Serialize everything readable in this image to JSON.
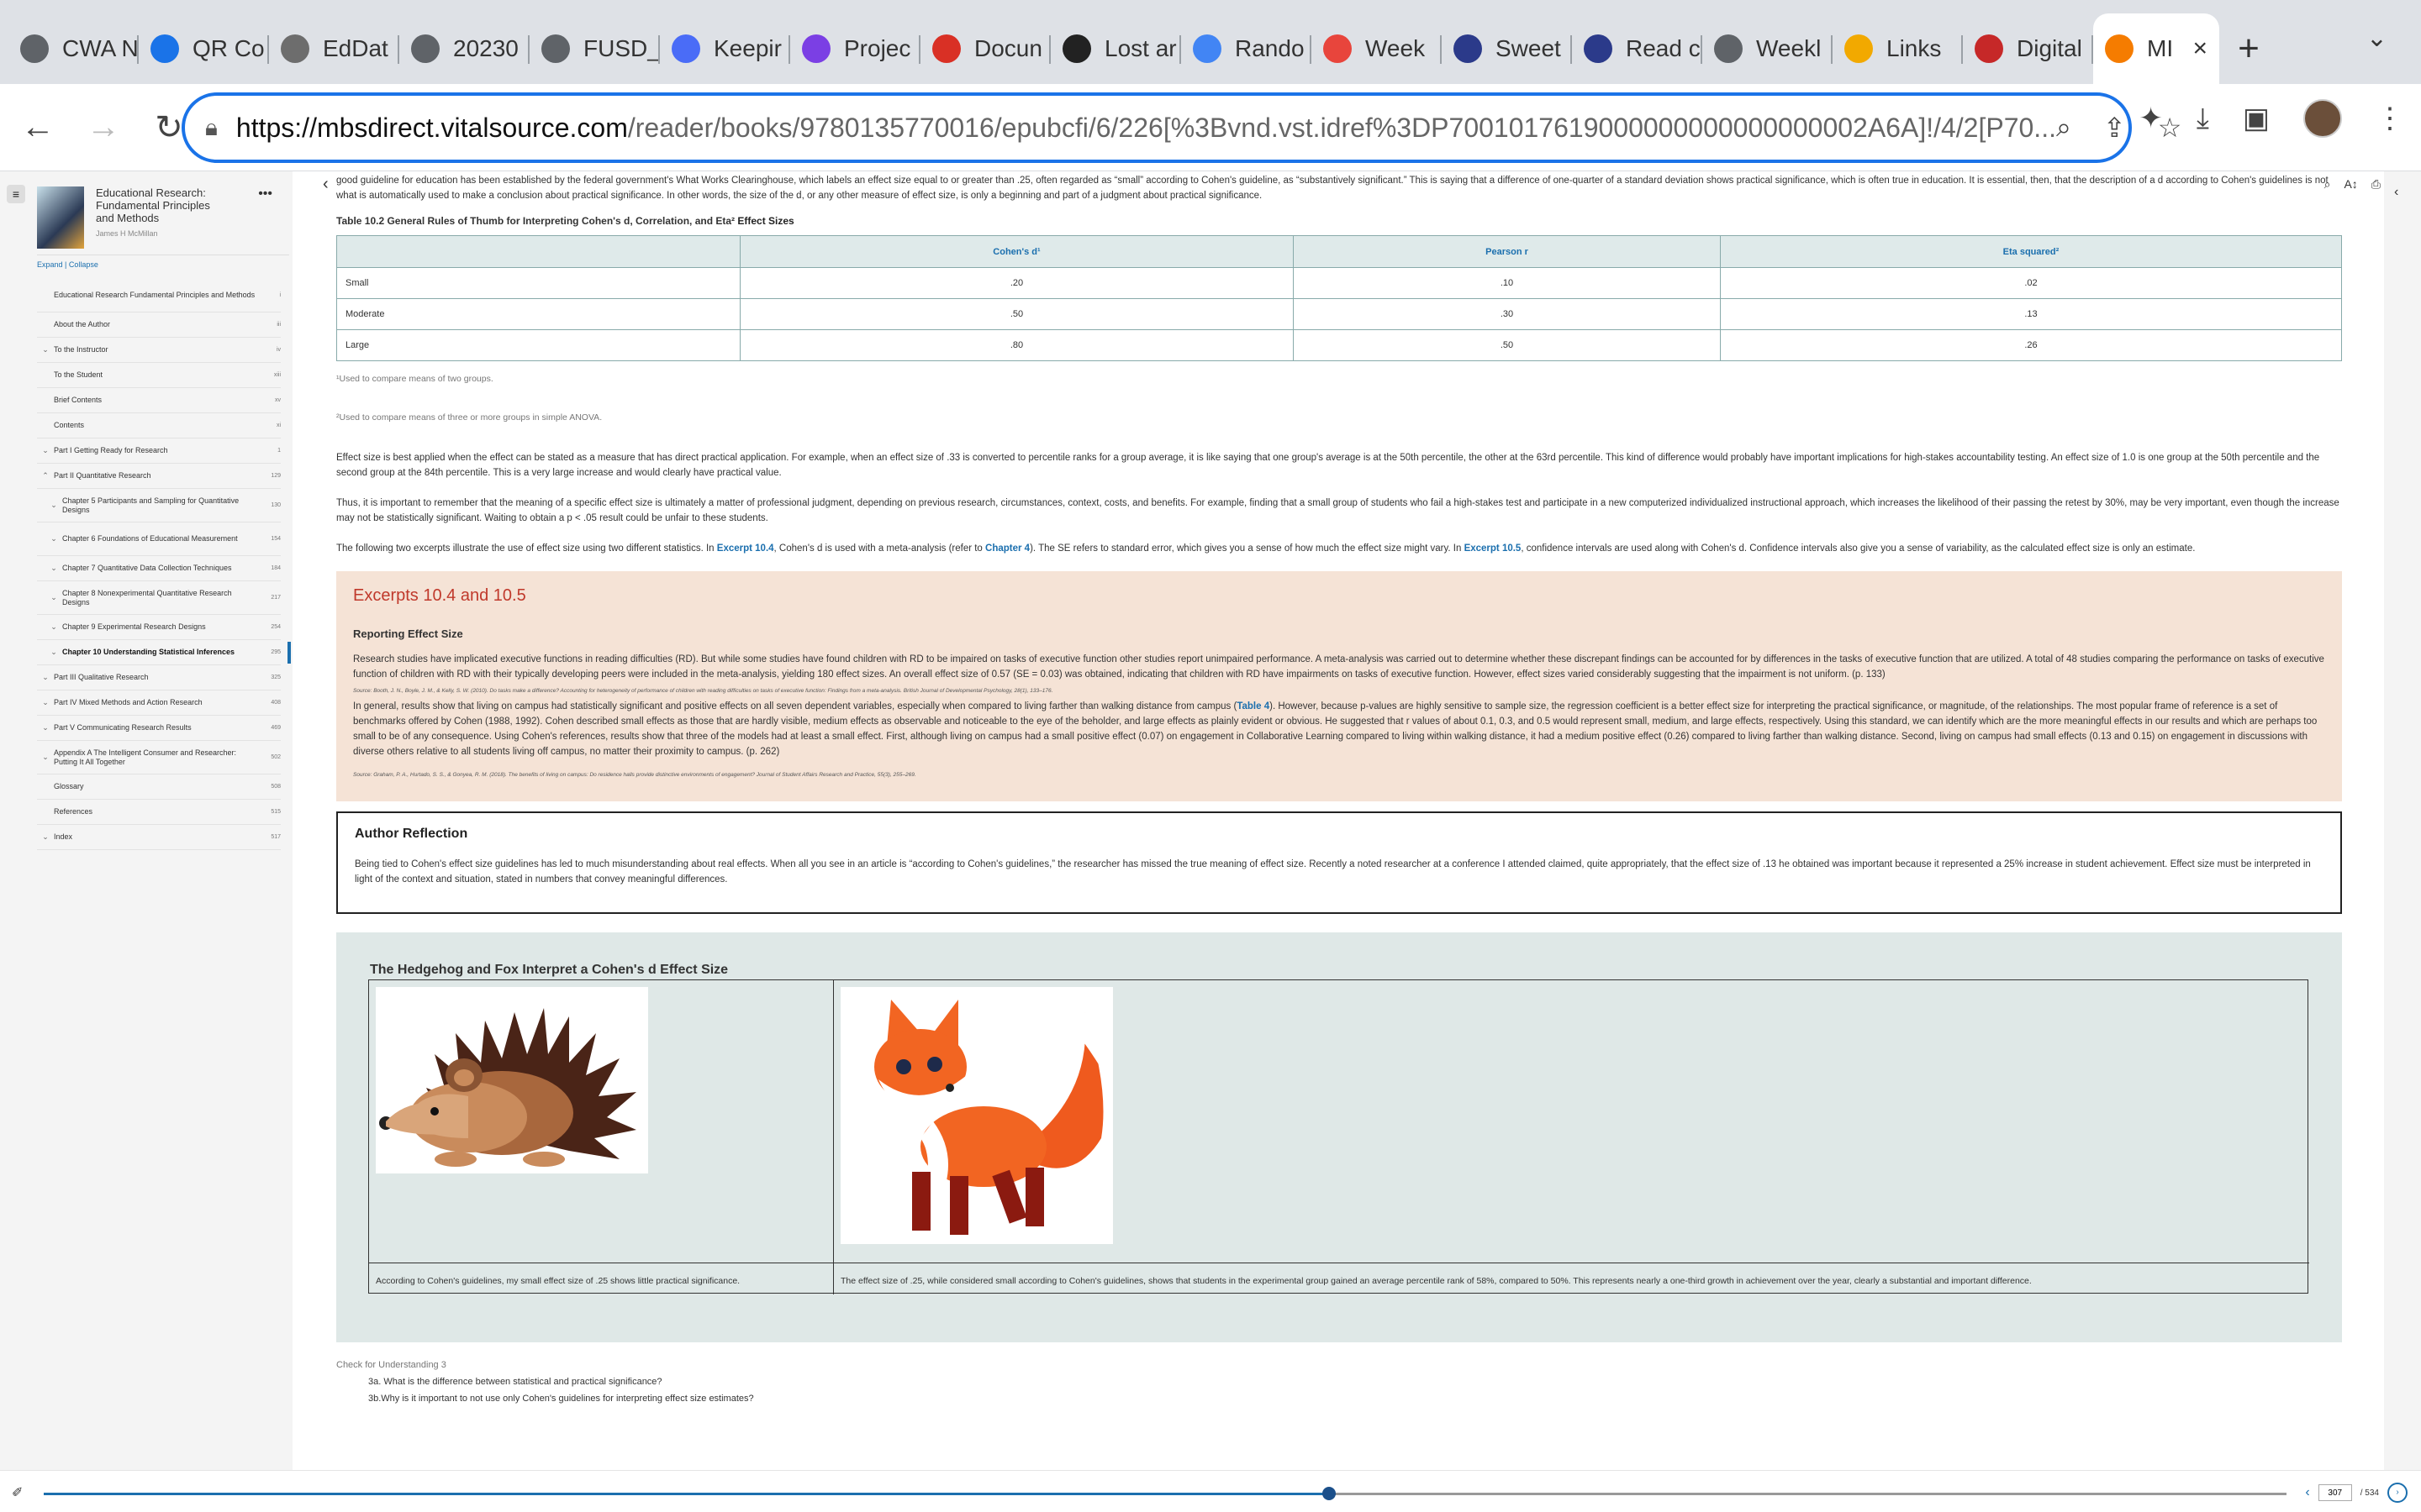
{
  "tabs": [
    {
      "label": "CWA N",
      "icon": "globe-icon",
      "color": "#5f6368"
    },
    {
      "label": "QR Co",
      "icon": "qr-icon",
      "color": "#1a73e8"
    },
    {
      "label": "EdDat",
      "icon": "doc-icon",
      "color": "#6d6d6d"
    },
    {
      "label": "20230",
      "icon": "globe-icon",
      "color": "#5f6368"
    },
    {
      "label": "FUSD_",
      "icon": "globe-icon",
      "color": "#5f6368"
    },
    {
      "label": "Keepir",
      "icon": "feather-icon",
      "color": "#4a6cf7"
    },
    {
      "label": "Projec",
      "icon": "c-icon",
      "color": "#7b3fe4"
    },
    {
      "label": "Docun",
      "icon": "docusign-icon",
      "color": "#d93025"
    },
    {
      "label": "Lost ar",
      "icon": "museum-icon",
      "color": "#222222"
    },
    {
      "label": "Rando",
      "icon": "google-icon",
      "color": "#4285f4"
    },
    {
      "label": "Week",
      "icon": "wheel-icon",
      "color": "#e8453c"
    },
    {
      "label": "Sweet",
      "icon": "gear-icon",
      "color": "#2b3a8a"
    },
    {
      "label": "Read c",
      "icon": "gear-icon",
      "color": "#2b3a8a"
    },
    {
      "label": "Weekl",
      "icon": "globe-icon",
      "color": "#5f6368"
    },
    {
      "label": "Links",
      "icon": "chart-icon",
      "color": "#f2a900"
    },
    {
      "label": "Digital",
      "icon": "book-icon",
      "color": "#c62828"
    },
    {
      "label": "MI",
      "icon": "vitalsource-icon",
      "color": "#f57c00",
      "active": true
    }
  ],
  "browser": {
    "url_host": "https://mbsdirect.vitalsource.com",
    "url_path": "/reader/books/9780135770016/epubcfi/6/226[%3Bvnd.vst.idref%3DP7001017619000000000000000002A6A]!/4/2[P70...",
    "new_tab_label": "+"
  },
  "book": {
    "title": "Educational Research: Fundamental Principles and Methods",
    "author": "James H McMillan",
    "more": "•••",
    "expand": "Expand",
    "sep": "|",
    "collapse": "Collapse"
  },
  "toc": [
    {
      "label": "Educational Research Fundamental Principles and Methods",
      "page": "i",
      "lvl": 0,
      "two": true,
      "chev": ""
    },
    {
      "label": "About the Author",
      "page": "iii",
      "lvl": 0,
      "chev": ""
    },
    {
      "label": "To the Instructor",
      "page": "iv",
      "lvl": 1,
      "chev": "⌄"
    },
    {
      "label": "To the Student",
      "page": "xiii",
      "lvl": 0,
      "chev": ""
    },
    {
      "label": "Brief Contents",
      "page": "xv",
      "lvl": 0,
      "chev": ""
    },
    {
      "label": "Contents",
      "page": "xi",
      "lvl": 0,
      "chev": ""
    },
    {
      "label": "Part I Getting Ready for Research",
      "page": "1",
      "lvl": 1,
      "chev": "⌄"
    },
    {
      "label": "Part II Quantitative Research",
      "page": "129",
      "lvl": 1,
      "chev": "⌃"
    },
    {
      "label": "Chapter 5 Participants and Sampling for Quantitative Designs",
      "page": "130",
      "lvl": 2,
      "two": true,
      "chev": "⌄"
    },
    {
      "label": "Chapter 6 Foundations of Educational Measurement",
      "page": "154",
      "lvl": 2,
      "two": true,
      "chev": "⌄"
    },
    {
      "label": "Chapter 7 Quantitative Data Collection Techniques",
      "page": "184",
      "lvl": 2,
      "chev": "⌄"
    },
    {
      "label": "Chapter 8 Nonexperimental Quantitative Research Designs",
      "page": "217",
      "lvl": 2,
      "two": true,
      "chev": "⌄"
    },
    {
      "label": "Chapter 9 Experimental Research Designs",
      "page": "254",
      "lvl": 2,
      "chev": "⌄"
    },
    {
      "label": "Chapter 10 Understanding Statistical Inferences",
      "page": "295",
      "lvl": 2,
      "chev": "⌄",
      "current": true
    },
    {
      "label": "Part III Qualitative Research",
      "page": "325",
      "lvl": 1,
      "chev": "⌄"
    },
    {
      "label": "Part IV Mixed Methods and Action Research",
      "page": "408",
      "lvl": 1,
      "chev": "⌄"
    },
    {
      "label": "Part V Communicating Research Results",
      "page": "469",
      "lvl": 1,
      "chev": "⌄"
    },
    {
      "label": "Appendix A The Intelligent Consumer and Researcher: Putting It All Together",
      "page": "502",
      "lvl": 1,
      "two": true,
      "chev": "⌄"
    },
    {
      "label": "Glossary",
      "page": "508",
      "lvl": 0,
      "chev": ""
    },
    {
      "label": "References",
      "page": "515",
      "lvl": 0,
      "chev": ""
    },
    {
      "label": "Index",
      "page": "517",
      "lvl": 1,
      "chev": "⌄"
    }
  ],
  "content": {
    "intro": "good guideline for education has been established by the federal government's What Works Clearinghouse, which labels an effect size equal to or greater than .25, often regarded as “small” according to Cohen's guideline, as “substantively significant.” This is saying that a difference of one-quarter of a standard deviation shows practical significance, which is often true in education. It is essential, then, that the description of a d according to Cohen's guidelines is not what is automatically used to make a conclusion about practical significance. In other words, the size of the d, or any other measure of effect size, is only a beginning and part of a judgment about practical significance.",
    "table_caption": "Table 10.2 General Rules of Thumb for Interpreting Cohen's d, Correlation, and Eta²",
    "table_caption_link": "Effect Sizes",
    "table_headers": [
      "",
      "Cohen's d¹",
      "Pearson r",
      "Eta squared²"
    ],
    "table_rows": [
      [
        "Small",
        ".20",
        ".10",
        ".02"
      ],
      [
        "Moderate",
        ".50",
        ".30",
        ".13"
      ],
      [
        "Large",
        ".80",
        ".50",
        ".26"
      ]
    ],
    "foot1": "¹Used to compare means of two groups.",
    "foot2": "²Used to compare means of three or more groups in simple ANOVA.",
    "p1": "Effect size is best applied when the effect can be stated as a measure that has direct practical application. For example, when an effect size of .33 is converted to percentile ranks for a group average, it is like saying that one group's average is at the 50th percentile, the other at the 63rd percentile. This kind of difference would probably have important implications for high-stakes accountability testing. An effect size of 1.0 is one group at the 50th percentile and the second group at the 84th percentile. This is a very large increase and would clearly have practical value.",
    "p2": "Thus, it is important to remember that the meaning of a specific effect size is ultimately a matter of professional judgment, depending on previous research, circumstances, context, costs, and benefits. For example, finding that a small group of students who fail a high-stakes test and participate in a new computerized individualized instructional approach, which increases the likelihood of their passing the retest by 30%, may be very important, even though the increase may not be statistically significant. Waiting to obtain a p < .05 result could be unfair to these students.",
    "p3_a": "The following two excerpts illustrate the use of effect size using two different statistics. In",
    "p3_link1": "Excerpt 10.4",
    "p3_b": ", Cohen's d is used with a meta-analysis (refer to",
    "p3_link2": "Chapter 4",
    "p3_c": "). The SE refers to standard error, which gives you a sense of how much the effect size might vary. In",
    "p3_link3": "Excerpt 10.5",
    "p3_d": ", confidence intervals are used along with Cohen's d. Confidence intervals also give you a sense of variability, as the calculated effect size is only an estimate.",
    "excerpt_title": "Excerpts 10.4 and 10.5",
    "excerpt_sub": "Reporting Effect Size",
    "excerpt_p1": "Research studies have implicated executive functions in reading difficulties (RD). But while some studies have found children with RD to be impaired on tasks of executive function other studies report unimpaired performance. A meta-analysis was carried out to determine whether these discrepant findings can be accounted for by differences in the tasks of executive function that are utilized. A total of 48 studies comparing the performance on tasks of executive function of children with RD with their typically developing peers were included in the meta-analysis, yielding 180 effect sizes. An overall effect size of 0.57 (SE = 0.03) was obtained, indicating that children with RD have impairments on tasks of executive function. However, effect sizes varied considerably suggesting that the impairment is not uniform. (p. 133)",
    "excerpt_src1": "Source: Booth, J. N., Boyle, J. M., & Kelly, S. W. (2010). Do tasks make a difference? Accounting for heterogeneity of performance of children with reading difficulties on tasks of executive function: Findings from a meta-analysis. British Journal of Developmental Psychology, 28(1), 133–176.",
    "excerpt_p2_a": "In general, results show that living on campus had statistically significant and positive effects on all seven dependent variables, especially when compared to living farther than walking distance from campus (",
    "excerpt_p2_link": "Table 4",
    "excerpt_p2_b": "). However, because p-values are highly sensitive to sample size, the regression coefficient is a better effect size for interpreting the practical significance, or magnitude, of the relationships. The most popular frame of reference is a set of benchmarks offered by Cohen (1988, 1992). Cohen described small effects as those that are hardly visible, medium effects as observable and noticeable to the eye of the beholder, and large effects as plainly evident or obvious. He suggested that r values of about 0.1, 0.3, and 0.5 would represent small, medium, and large effects, respectively. Using this standard, we can identify which are the more meaningful effects in our results and which are perhaps too small to be of any consequence. Using Cohen's references, results show that three of the models had at least a small effect. First, although living on campus had a small positive effect (0.07) on engagement in Collaborative Learning compared to living within walking distance, it had a medium positive effect (0.26) compared to living farther than walking distance. Second, living on campus had small effects (0.13 and 0.15) on engagement in discussions with diverse others relative to all students living off campus, no matter their proximity to campus. (p. 262)",
    "excerpt_src2": "Source: Graham, P. A., Hurtado, S. S., & Gonyea, R. M. (2018). The benefits of living on campus: Do residence halls provide distinctive environments of engagement? Journal of Student Affairs Research and Practice, 55(3), 255–269.",
    "reflect_title": "Author Reflection",
    "reflect_text": "Being tied to Cohen's effect size guidelines has led to much misunderstanding about real effects. When all you see in an article is “according to Cohen's guidelines,” the researcher has missed the true meaning of effect size. Recently a noted researcher at a conference I attended claimed, quite appropriately, that the effect size of .13 he obtained was important because it represented a 25% increase in student achievement. Effect size must be interpreted in light of the context and situation, stated in numbers that convey meaningful differences.",
    "hf_title": "The Hedgehog and Fox Interpret a Cohen's d Effect Size",
    "hf_hedgehog": "According to Cohen's guidelines, my small effect size of .25 shows little practical significance.",
    "hf_fox": "The effect size of .25, while considered small according to Cohen's guidelines, shows that students in the experimental group gained an average percentile rank of 58%, compared to 50%. This represents nearly a one-third growth in achievement over the year, clearly a substantial and important difference.",
    "check_title": "Check for Understanding 3",
    "check_q1": "3a. What is the difference between statistical and practical significance?",
    "check_q2": "3b.Why is it important to not use only Cohen's guidelines for interpreting effect size estimates?"
  },
  "pager": {
    "current": "307",
    "total": "/ 534",
    "progress": 0.573
  },
  "colors": {
    "accent": "#1b6fae",
    "excerpt_bg": "#f5e3d6",
    "excerpt_title": "#c0392b",
    "hf_bg": "#dfe8e7"
  }
}
